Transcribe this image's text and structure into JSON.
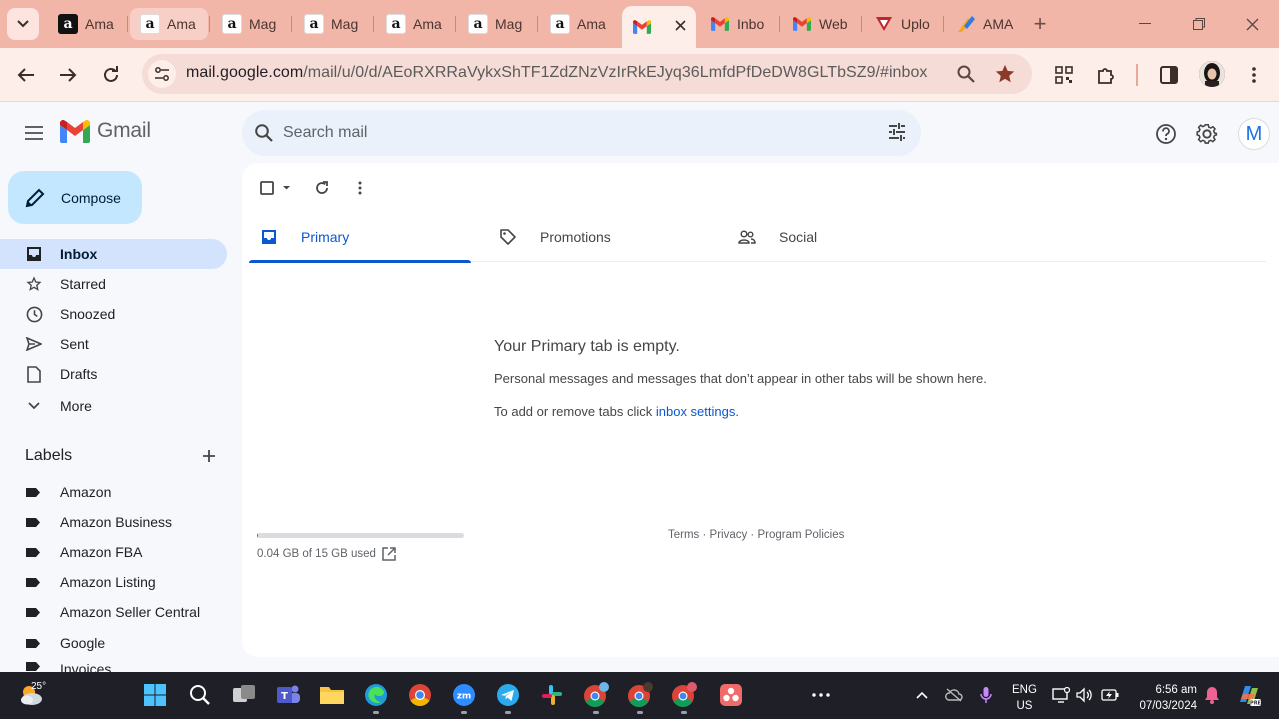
{
  "browser": {
    "tabs": [
      {
        "label": "Ama",
        "favicon": "amazon-icon"
      },
      {
        "label": "Ama",
        "favicon": "amazon-icon"
      },
      {
        "label": "Mag",
        "favicon": "amazon-icon"
      },
      {
        "label": "Mag",
        "favicon": "amazon-icon"
      },
      {
        "label": "Ama",
        "favicon": "amazon-icon"
      },
      {
        "label": "Mag",
        "favicon": "amazon-icon"
      },
      {
        "label": "Ama",
        "favicon": "amazon-icon"
      },
      {
        "label": "",
        "favicon": "gmail-icon",
        "active": true
      },
      {
        "label": "Inbo",
        "favicon": "gmail-icon"
      },
      {
        "label": "Web",
        "favicon": "gmail-icon"
      },
      {
        "label": "Uplo",
        "favicon": "upload-icon"
      },
      {
        "label": "AMA",
        "favicon": "ama-icon"
      }
    ],
    "url_host": "mail.google.com",
    "url_path": "/mail/u/0/d/AEoRXRRaVykxShTF1ZdZNzVzIrRkEJyq36LmfdPfDeDW8GLTbSZ9/#inbox",
    "accent": "#f2b6a9"
  },
  "gmail": {
    "brand": "Gmail",
    "search_placeholder": "Search mail",
    "avatar_letter": "M",
    "compose_label": "Compose",
    "nav": [
      {
        "label": "Inbox",
        "icon": "inbox-icon",
        "active": true
      },
      {
        "label": "Starred",
        "icon": "star-icon"
      },
      {
        "label": "Snoozed",
        "icon": "clock-icon"
      },
      {
        "label": "Sent",
        "icon": "send-icon"
      },
      {
        "label": "Drafts",
        "icon": "draft-icon"
      },
      {
        "label": "More",
        "icon": "chevron-down-icon"
      }
    ],
    "labels_title": "Labels",
    "labels": [
      "Amazon",
      "Amazon Business",
      "Amazon FBA",
      "Amazon Listing",
      "Amazon Seller Central",
      "Google",
      "Invoices"
    ],
    "tabs": [
      {
        "label": "Primary",
        "icon": "inbox-icon",
        "active": true
      },
      {
        "label": "Promotions",
        "icon": "tag-icon"
      },
      {
        "label": "Social",
        "icon": "people-icon"
      }
    ],
    "empty_title": "Your Primary tab is empty.",
    "empty_body": "Personal messages and messages that don’t appear in other tabs will be shown here.",
    "empty_tip_prefix": "To add or remove tabs click ",
    "empty_tip_link": "inbox settings",
    "empty_tip_suffix": ".",
    "storage_text": "0.04 GB of 15 GB used",
    "storage_fraction": 0.003,
    "footer_links": "Terms · Privacy · Program Policies"
  },
  "taskbar": {
    "temperature": "25°",
    "lang_top": "ENG",
    "lang_bottom": "US",
    "time": "6:56 am",
    "date": "07/03/2024"
  }
}
